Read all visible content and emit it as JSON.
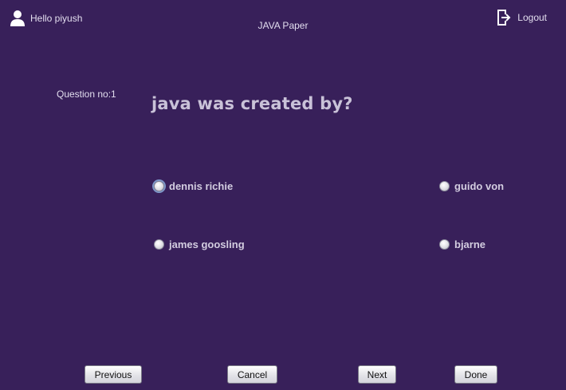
{
  "header": {
    "greeting": "Hello piyush",
    "paper_title": "JAVA Paper",
    "logout_label": "Logout",
    "user_icon": "user-icon",
    "logout_icon": "logout-icon"
  },
  "question": {
    "number_label": "Question no:1",
    "text": "java was created by?",
    "options": [
      {
        "label": "dennis richie",
        "selected": false
      },
      {
        "label": "guido von",
        "selected": false
      },
      {
        "label": "james goosling",
        "selected": false
      },
      {
        "label": "bjarne",
        "selected": false
      }
    ]
  },
  "footer": {
    "previous_label": "Previous",
    "cancel_label": "Cancel",
    "next_label": "Next",
    "done_label": "Done"
  },
  "colors": {
    "background": "#38205a",
    "text": "#e2ddee",
    "question_text": "#c9c2d8"
  }
}
